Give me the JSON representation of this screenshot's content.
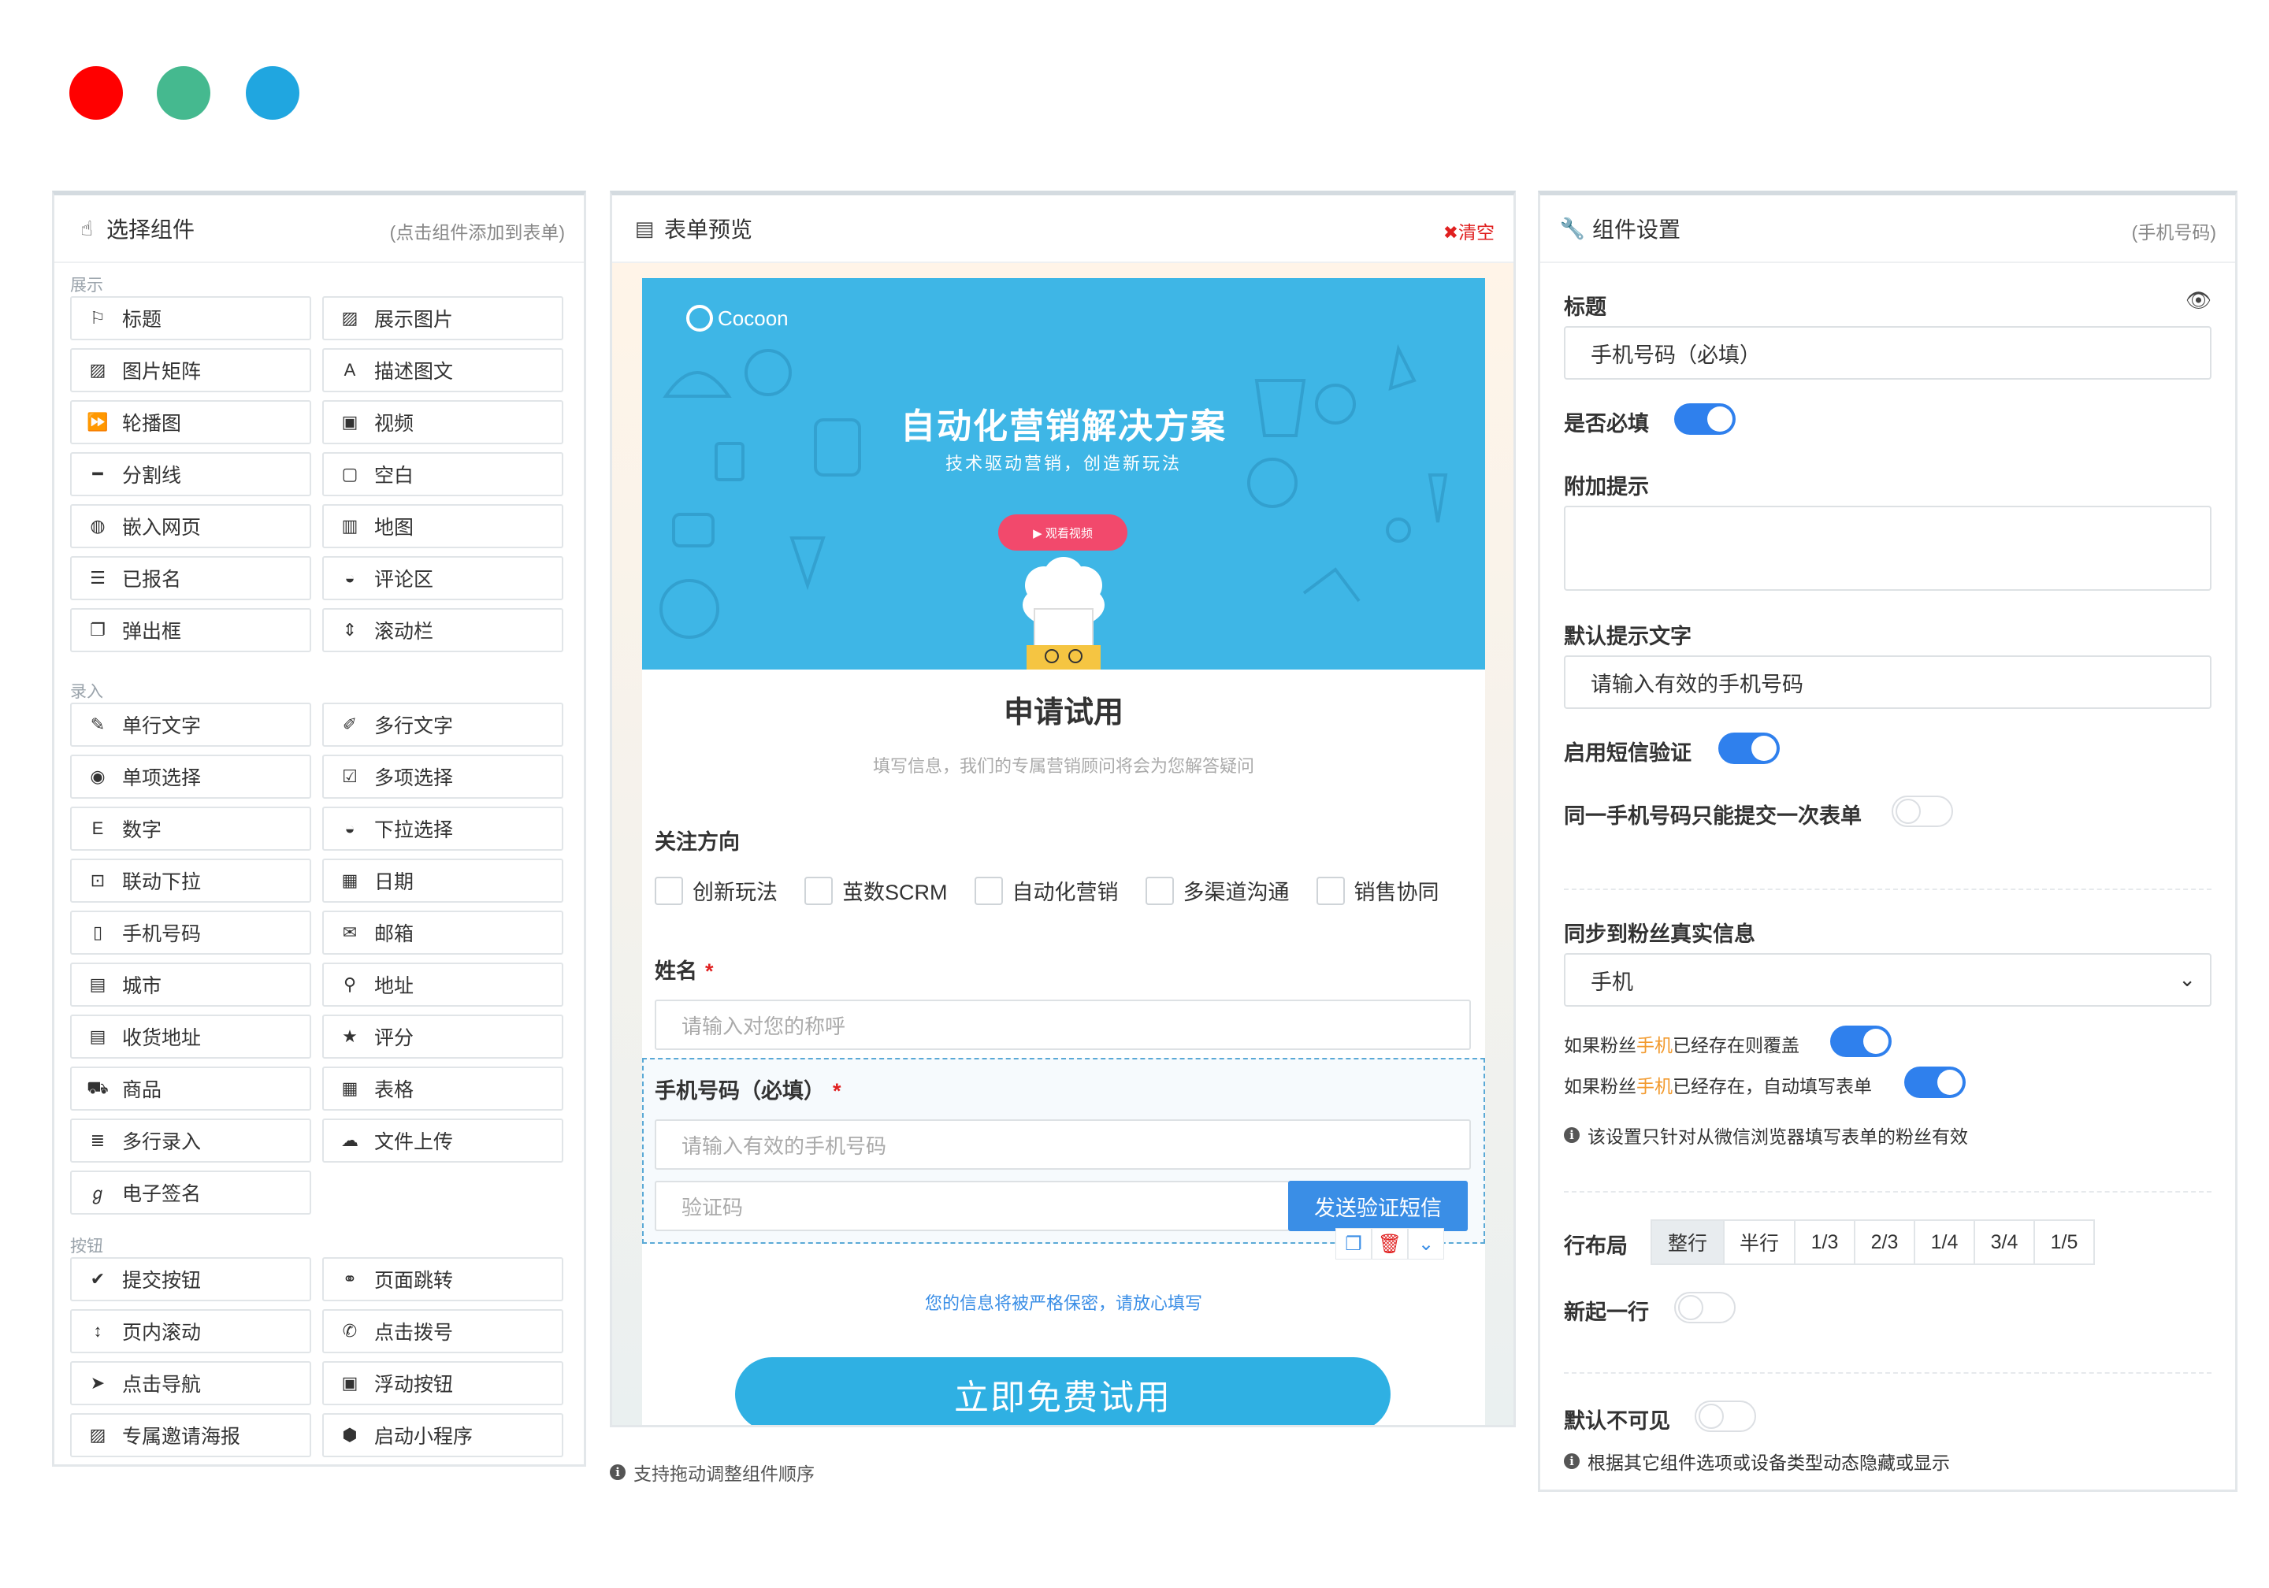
{
  "window": {
    "dots": [
      {
        "name": "red",
        "color": "#ff0000"
      },
      {
        "name": "green",
        "color": "#45b98f"
      },
      {
        "name": "blue",
        "color": "#20a6e0"
      }
    ]
  },
  "components": {
    "title": "选择组件",
    "hint": "(点击组件添加到表单)",
    "sections": [
      {
        "label": "展示",
        "items": [
          {
            "label": "标题",
            "icon": "bookmark-icon",
            "glyph": "⚐"
          },
          {
            "label": "展示图片",
            "icon": "image-icon",
            "glyph": "▨"
          },
          {
            "label": "图片矩阵",
            "icon": "image-grid-icon",
            "glyph": "▨"
          },
          {
            "label": "描述图文",
            "icon": "font-icon",
            "glyph": "A"
          },
          {
            "label": "轮播图",
            "icon": "fast-forward-icon",
            "glyph": "⏩"
          },
          {
            "label": "视频",
            "icon": "video-file-icon",
            "glyph": "▣"
          },
          {
            "label": "分割线",
            "icon": "minus-icon",
            "glyph": "━"
          },
          {
            "label": "空白",
            "icon": "square-icon",
            "glyph": "▢"
          },
          {
            "label": "嵌入网页",
            "icon": "globe-icon",
            "glyph": "◍"
          },
          {
            "label": "地图",
            "icon": "map-icon",
            "glyph": "▥"
          },
          {
            "label": "已报名",
            "icon": "list-icon",
            "glyph": "☰"
          },
          {
            "label": "评论区",
            "icon": "comments-icon",
            "glyph": "◒"
          },
          {
            "label": "弹出框",
            "icon": "clone-icon",
            "glyph": "❐"
          },
          {
            "label": "滚动栏",
            "icon": "sort-icon",
            "glyph": "⇕"
          }
        ]
      },
      {
        "label": "录入",
        "items": [
          {
            "label": "单行文字",
            "icon": "pencil-icon",
            "glyph": "✎"
          },
          {
            "label": "多行文字",
            "icon": "edit-icon",
            "glyph": "✐"
          },
          {
            "label": "单项选择",
            "icon": "radio-icon",
            "glyph": "◉"
          },
          {
            "label": "多项选择",
            "icon": "check-square-icon",
            "glyph": "☑"
          },
          {
            "label": "数字",
            "icon": "number-icon",
            "glyph": "E"
          },
          {
            "label": "下拉选择",
            "icon": "chevron-circle-icon",
            "glyph": "◒"
          },
          {
            "label": "联动下拉",
            "icon": "caret-square-icon",
            "glyph": "⊡"
          },
          {
            "label": "日期",
            "icon": "calendar-icon",
            "glyph": "▦"
          },
          {
            "label": "手机号码",
            "icon": "mobile-icon",
            "glyph": "▯"
          },
          {
            "label": "邮箱",
            "icon": "envelope-icon",
            "glyph": "✉"
          },
          {
            "label": "城市",
            "icon": "building-icon",
            "glyph": "▤"
          },
          {
            "label": "地址",
            "icon": "map-marker-icon",
            "glyph": "⚲"
          },
          {
            "label": "收货地址",
            "icon": "address-card-icon",
            "glyph": "▤"
          },
          {
            "label": "评分",
            "icon": "star-icon",
            "glyph": "★"
          },
          {
            "label": "商品",
            "icon": "shopping-cart-icon",
            "glyph": "⛟"
          },
          {
            "label": "表格",
            "icon": "table-icon",
            "glyph": "▦"
          },
          {
            "label": "多行录入",
            "icon": "align-left-icon",
            "glyph": "≣"
          },
          {
            "label": "文件上传",
            "icon": "cloud-upload-icon",
            "glyph": "☁"
          },
          {
            "label": "电子签名",
            "icon": "signature-icon",
            "glyph": "ℊ"
          }
        ]
      },
      {
        "label": "按钮",
        "items": [
          {
            "label": "提交按钮",
            "icon": "check-circle-icon",
            "glyph": "✔"
          },
          {
            "label": "页面跳转",
            "icon": "link-icon",
            "glyph": "⚭"
          },
          {
            "label": "页内滚动",
            "icon": "arrows-vertical-icon",
            "glyph": "↕"
          },
          {
            "label": "点击拨号",
            "icon": "phone-icon",
            "glyph": "✆"
          },
          {
            "label": "点击导航",
            "icon": "location-arrow-icon",
            "glyph": "➤"
          },
          {
            "label": "浮动按钮",
            "icon": "play-square-icon",
            "glyph": "▣"
          },
          {
            "label": "专属邀请海报",
            "icon": "poster-icon",
            "glyph": "▨"
          },
          {
            "label": "启动小程序",
            "icon": "cube-icon",
            "glyph": "⬢"
          }
        ]
      }
    ]
  },
  "preview": {
    "title": "表单预览",
    "clear_label": "✖清空",
    "banner": {
      "logo_text": "Cocoon",
      "title": "自动化营销解决方案",
      "subtitle": "技术驱动营销，创造新玩法",
      "video_button": "▶ 观看视频"
    },
    "form_title": "申请试用",
    "form_desc": "填写信息，我们的专属营销顾问将会为您解答疑问",
    "focus": {
      "label": "关注方向",
      "options": [
        "创新玩法",
        "茧数SCRM",
        "自动化营销",
        "多渠道沟通",
        "销售协同"
      ]
    },
    "name_field": {
      "label": "姓名",
      "required": "*",
      "placeholder": "请输入对您的称呼"
    },
    "phone_field": {
      "label": "手机号码（必填）",
      "required": "*",
      "placeholder": "请输入有效的手机号码",
      "code_placeholder": "验证码",
      "send_button": "发送验证短信"
    },
    "privacy": "您的信息将被严格保密，请放心填写",
    "cta": "立即免费试用",
    "drag_note": "支持拖动调整组件顺序"
  },
  "settings": {
    "title": "组件设置",
    "hint": "(手机号码)",
    "title_label": "标题",
    "title_value": "手机号码（必填）",
    "required_label": "是否必填",
    "required_on": true,
    "extra_hint_label": "附加提示",
    "default_text_label": "默认提示文字",
    "default_text_value": "请输入有效的手机号码",
    "sms_label": "启用短信验证",
    "sms_on": true,
    "once_label": "同一手机号码只能提交一次表单",
    "once_on": false,
    "sync_label": "同步到粉丝真实信息",
    "sync_value": "手机",
    "overwrite": {
      "pre": "如果粉丝",
      "hl": "手机",
      "post": "已经存在则覆盖",
      "on": true
    },
    "autofill": {
      "pre": "如果粉丝",
      "hl": "手机",
      "post": "已经存在，自动填写表单",
      "on": true
    },
    "wechat_note": "该设置只针对从微信浏览器填写表单的粉丝有效",
    "layout_label": "行布局",
    "layout_options": [
      "整行",
      "半行",
      "1/3",
      "2/3",
      "1/4",
      "3/4",
      "1/5"
    ],
    "layout_selected": "整行",
    "newline_label": "新起一行",
    "newline_on": false,
    "hidden_label": "默认不可见",
    "hidden_on": false,
    "hidden_note": "根据其它组件选项或设备类型动态隐藏或显示"
  }
}
